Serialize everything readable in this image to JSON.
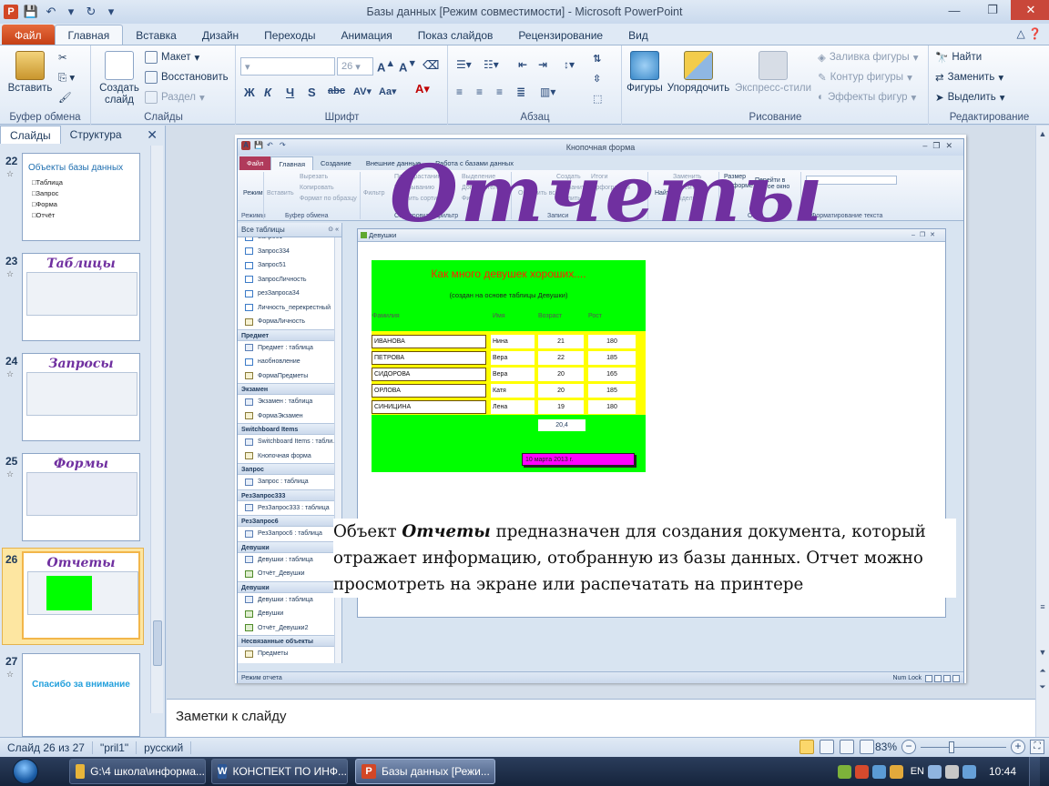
{
  "window": {
    "title": "Базы данных [Режим совместимости]  -  Microsoft PowerPoint",
    "controls": [
      "—",
      "❐",
      "✕"
    ]
  },
  "ribbon_tabs": [
    "Файл",
    "Главная",
    "Вставка",
    "Дизайн",
    "Переходы",
    "Анимация",
    "Показ слайдов",
    "Рецензирование",
    "Вид"
  ],
  "ribbon": {
    "clipboard": {
      "label": "Буфер обмена",
      "paste": "Вставить"
    },
    "slides": {
      "label": "Слайды",
      "new_slide": "Создать слайд",
      "layout": "Макет",
      "reset": "Восстановить",
      "section": "Раздел"
    },
    "font": {
      "label": "Шрифт",
      "size": "26"
    },
    "paragraph": {
      "label": "Абзац"
    },
    "drawing": {
      "label": "Рисование",
      "shapes": "Фигуры",
      "arrange": "Упорядочить",
      "quick_styles": "Экспресс-стили",
      "fill": "Заливка фигуры",
      "outline": "Контур фигуры",
      "effects": "Эффекты фигур"
    },
    "editing": {
      "label": "Редактирование",
      "find": "Найти",
      "replace": "Заменить",
      "select": "Выделить"
    }
  },
  "left_pane": {
    "tabs": [
      "Слайды",
      "Структура"
    ],
    "thumbnails": [
      {
        "num": "22",
        "title": "Объекты базы данных",
        "items": [
          "Таблица",
          "Запрос",
          "Форма",
          "Отчёт"
        ]
      },
      {
        "num": "23",
        "title": "Таблицы"
      },
      {
        "num": "24",
        "title": "Запросы"
      },
      {
        "num": "25",
        "title": "Формы"
      },
      {
        "num": "26",
        "title": "Отчеты"
      },
      {
        "num": "27",
        "title": "Спасибо за внимание"
      }
    ]
  },
  "slide": {
    "title": "Отчеты",
    "text_bold": "Отчеты",
    "text_before": "Объект ",
    "text_after": " предназначен для создания документа, который отражает информацию, отобранную из базы данных. Отчет можно просмотреть на экране или распечатать на принтере"
  },
  "access": {
    "title": "Кнопочная форма",
    "tabs": [
      "Файл",
      "Главная",
      "Создание",
      "Внешние данные",
      "Работа с базами данных"
    ],
    "ribbon_items": {
      "view": "Режим",
      "paste": "Вставить",
      "cut": "Вырезать",
      "copy": "Копировать",
      "format_painter": "Формат по образцу",
      "filter": "Фильтр",
      "asc": "По возрастанию",
      "desc": "По убыванию",
      "remove_sort": "Удалить сортировку",
      "refresh": "Обновить все",
      "create": "Создать",
      "save": "Сохранить",
      "delete": "Удалить",
      "totals": "Итоги",
      "spelling": "Орфография",
      "replace": "Заменить",
      "goto": "Перейти",
      "select": "Выделить",
      "selection_part": "Выделение",
      "advanced_part": "Дополнительно",
      "filter_part": "Фильтр",
      "find_part": "Найти",
      "switch_windows_part": "Перейти в другое окно",
      "size_part": "Размер",
      "to_form_part": "по форме",
      "clipboard_part": "Буфер обмена",
      "records_part": "Записи",
      "formatting": "Форматирование текста",
      "sort_group_part": "Сортировка и фильтр",
      "windows_part": "Окно",
      "views_label": "Режимы"
    },
    "nav_header": "Все таблицы",
    "nav": [
      {
        "type": "item",
        "label": "Запрос1",
        "icon": "q"
      },
      {
        "type": "item",
        "label": "Запрос334",
        "icon": "q"
      },
      {
        "type": "item",
        "label": "Запрос51",
        "icon": "q"
      },
      {
        "type": "item",
        "label": "ЗапросЛичность",
        "icon": "q"
      },
      {
        "type": "item",
        "label": "резЗапроса34",
        "icon": "q"
      },
      {
        "type": "item",
        "label": "Личность_перекрестный",
        "icon": "q"
      },
      {
        "type": "item",
        "label": "ФормаЛичность",
        "icon": "f"
      },
      {
        "type": "group",
        "label": "Предмет"
      },
      {
        "type": "item",
        "label": "Предмет : таблица",
        "icon": "t"
      },
      {
        "type": "item",
        "label": "наобновление",
        "icon": "q"
      },
      {
        "type": "item",
        "label": "ФормаПредметы",
        "icon": "f"
      },
      {
        "type": "group",
        "label": "Экзамен"
      },
      {
        "type": "item",
        "label": "Экзамен : таблица",
        "icon": "t"
      },
      {
        "type": "item",
        "label": "ФормаЭкзамен",
        "icon": "f"
      },
      {
        "type": "group",
        "label": "Switchboard Items"
      },
      {
        "type": "item",
        "label": "Switchboard Items : табли...",
        "icon": "t"
      },
      {
        "type": "item",
        "label": "Кнопочная форма",
        "icon": "f"
      },
      {
        "type": "group",
        "label": "Запрос"
      },
      {
        "type": "item",
        "label": "Запрос : таблица",
        "icon": "t"
      },
      {
        "type": "group",
        "label": "РезЗапрос333"
      },
      {
        "type": "item",
        "label": "РезЗапрос333 : таблица",
        "icon": "t"
      },
      {
        "type": "group",
        "label": "РезЗапрос6"
      },
      {
        "type": "item",
        "label": "РезЗапрос6 : таблица",
        "icon": "t"
      },
      {
        "type": "group",
        "label": "Девушки"
      },
      {
        "type": "item",
        "label": "Девушки : таблица",
        "icon": "t"
      },
      {
        "type": "item",
        "label": "Отчёт_Девушки",
        "icon": "r"
      },
      {
        "type": "group",
        "label": "Девушки"
      },
      {
        "type": "item",
        "label": "Девушки : таблица",
        "icon": "t"
      },
      {
        "type": "item",
        "label": "Девушки",
        "icon": "r"
      },
      {
        "type": "item",
        "label": "Отчёт_Девушки2",
        "icon": "r"
      },
      {
        "type": "group",
        "label": "Несвязанные объекты"
      },
      {
        "type": "item",
        "label": "Предметы",
        "icon": "f"
      }
    ],
    "report_window_title": "Девушки",
    "report": {
      "title": "Как много девушек хороших....",
      "subtitle": "(создан на основе таблицы Девушки)",
      "headers": [
        "Фамилия",
        "Имя",
        "Возраст",
        "Рост"
      ],
      "rows": [
        [
          "ИВАНОВА",
          "Нина",
          "21",
          "180"
        ],
        [
          "ПЕТРОВА",
          "Вера",
          "22",
          "185"
        ],
        [
          "СИДОРОВА",
          "Вера",
          "20",
          "165"
        ],
        [
          "ОРЛОВА",
          "Катя",
          "20",
          "185"
        ],
        [
          "СИНИЦИНА",
          "Лена",
          "19",
          "180"
        ]
      ],
      "average": "20,4",
      "date": "10 марта 2013 г."
    },
    "status_left": "Режим отчета",
    "status_right": "Num Lock"
  },
  "notes": {
    "placeholder": "Заметки к слайду"
  },
  "statusbar": {
    "slide_info": "Слайд 26 из 27",
    "theme": "\"pril1\"",
    "language": "русский",
    "zoom": "83%",
    "zoom_level": 0.36
  },
  "taskbar": {
    "items": [
      {
        "label": "G:\\4 школа\\информа...",
        "icon_color": "#e8b53a",
        "glyph": ""
      },
      {
        "label": "КОНСПЕКТ ПО ИНФ...",
        "icon_color": "#2b5797",
        "glyph": "W"
      },
      {
        "label": "Базы данных [Режи...",
        "icon_color": "#d24726",
        "glyph": "P"
      }
    ],
    "language": "EN",
    "clock": "10:44"
  }
}
